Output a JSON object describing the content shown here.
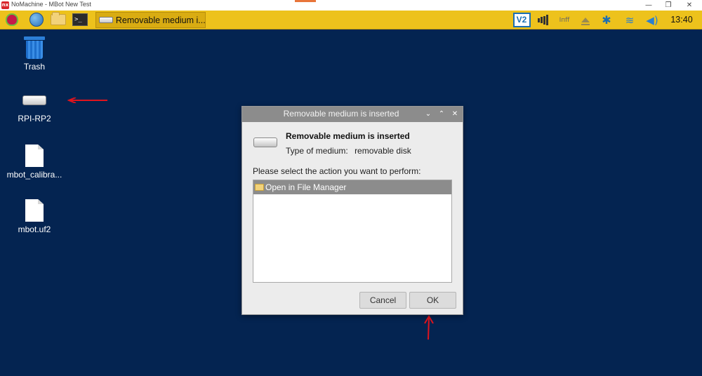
{
  "window": {
    "logo_text": "nx",
    "title": "NoMachine - MBot New Test",
    "minimize_glyph": "—",
    "maximize_glyph": "❐",
    "close_glyph": "✕"
  },
  "taskbar": {
    "terminal_glyph": ">_",
    "task_item_label": "Removable medium i...",
    "vnc_label": "V2",
    "cpu_label": "Iпff",
    "bluetooth_glyph": "✱",
    "wifi_glyph": "≋",
    "volume_glyph": "◀)",
    "clock": "13:40"
  },
  "desktop": {
    "icons": [
      {
        "label": "Trash"
      },
      {
        "label": "RPI-RP2"
      },
      {
        "label": "mbot_calibra..."
      },
      {
        "label": "mbot.uf2"
      }
    ]
  },
  "dialog": {
    "title": "Removable medium is inserted",
    "title_controls": {
      "shade": "⌄",
      "maximize": "⌃",
      "close": "✕"
    },
    "heading": "Removable medium is inserted",
    "type_label": "Type of medium:",
    "type_value": "removable disk",
    "prompt": "Please select the action you want to perform:",
    "actions": [
      {
        "label": "Open in File Manager",
        "selected": true
      }
    ],
    "cancel_label": "Cancel",
    "ok_label": "OK"
  },
  "colors": {
    "taskbar": "#edc21c",
    "desktop": "#042451",
    "dialog_titlebar": "#8c8c8c",
    "annotation_arrow": "#e0141e"
  }
}
